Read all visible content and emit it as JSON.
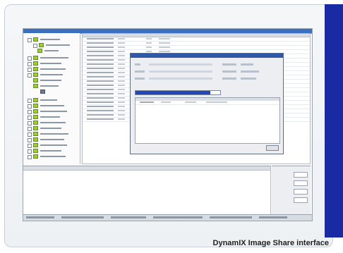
{
  "caption": "DynamIX Image Share interface",
  "colors": {
    "accent_bar": "#1a2aa3",
    "progress": "#2347b8"
  },
  "dialog": {
    "progress_fraction": 0.88
  }
}
